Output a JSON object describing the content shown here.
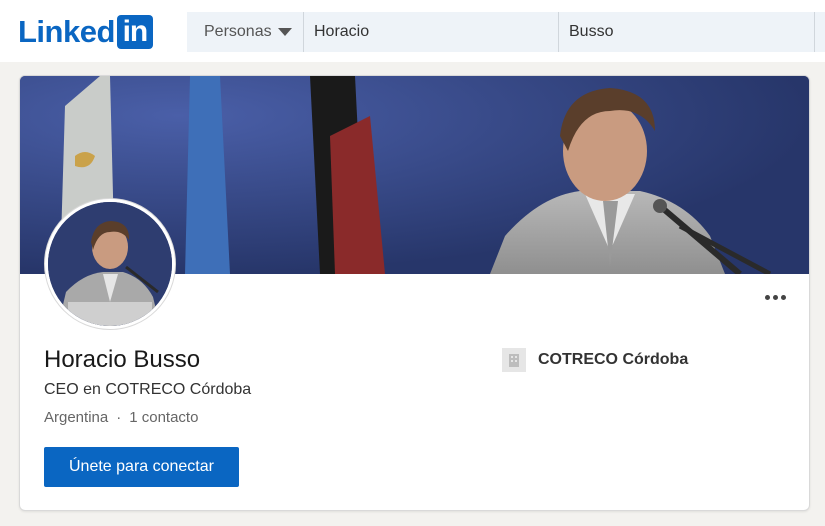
{
  "header": {
    "logo_text": "Linked",
    "logo_box_text": "in",
    "search": {
      "category_label": "Personas",
      "first_name_value": "Horacio",
      "last_name_value": "Busso"
    }
  },
  "profile": {
    "name": "Horacio Busso",
    "headline": "CEO en COTRECO Córdoba",
    "location": "Argentina",
    "separator": "·",
    "connections": "1 contacto",
    "join_button_label": "Únete para conectar",
    "current_company": "COTRECO Córdoba"
  },
  "colors": {
    "brand": "#0a66c2",
    "search_bg": "#eef3f8",
    "page_bg": "#f3f2ef"
  },
  "icons": {
    "dropdown": "caret-down-icon",
    "more": "ellipsis-icon",
    "company": "building-icon"
  }
}
